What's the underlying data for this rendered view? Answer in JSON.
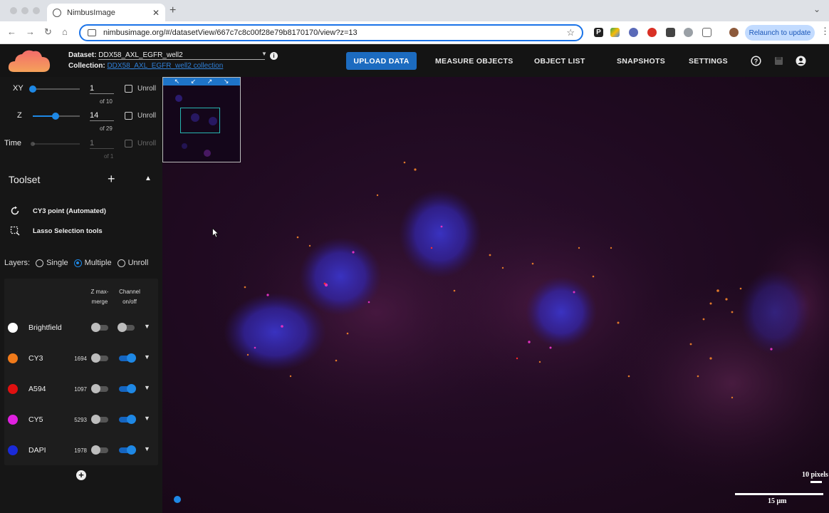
{
  "browser": {
    "tab_title": "NimbusImage",
    "url": "nimbusimage.org/#/datasetView/667c7c8c00f28e79b8170170/view?z=13",
    "relaunch_label": "Relaunch to update"
  },
  "header": {
    "dataset_label": "Dataset:",
    "dataset_name": "DDX58_AXL_EGFR_well2",
    "collection_label": "Collection:",
    "collection_name": "DDX58_AXL_EGFR_well2 collection",
    "nav": {
      "upload": "UPLOAD DATA",
      "measure": "MEASURE OBJECTS",
      "object_list": "OBJECT LIST",
      "snapshots": "SNAPSHOTS",
      "settings": "SETTINGS"
    }
  },
  "dimensions": {
    "xy": {
      "label": "XY",
      "value": "1",
      "of": "of 10",
      "unroll": "Unroll",
      "level": 0.0
    },
    "z": {
      "label": "Z",
      "value": "14",
      "of": "of 29",
      "unroll": "Unroll",
      "level": 0.46
    },
    "time": {
      "label": "Time",
      "value": "1",
      "of": "of 1",
      "unroll": "Unroll",
      "level": 0.0
    }
  },
  "toolset": {
    "title": "Toolset",
    "tools": [
      {
        "label": "CY3 point (Automated)",
        "icon": "refresh-icon"
      },
      {
        "label": "Lasso Selection tools",
        "icon": "lasso-select-icon"
      }
    ]
  },
  "layers": {
    "label": "Layers:",
    "options": [
      "Single",
      "Multiple",
      "Unroll"
    ],
    "selected": "Multiple"
  },
  "channels": {
    "col_zmax": "Z max-merge",
    "col_onoff": "Channel on/off",
    "rows": [
      {
        "name": "Brightfield",
        "value": "",
        "color": "#ffffff",
        "zmax": false,
        "on": false
      },
      {
        "name": "CY3",
        "value": "1694",
        "color": "#f07a1a",
        "zmax": false,
        "on": true
      },
      {
        "name": "A594",
        "value": "1097",
        "color": "#e01010",
        "zmax": false,
        "on": true
      },
      {
        "name": "CY5",
        "value": "5293",
        "color": "#e020e0",
        "zmax": false,
        "on": true
      },
      {
        "name": "DAPI",
        "value": "1978",
        "color": "#1a2ad8",
        "zmax": false,
        "on": true
      }
    ]
  },
  "viewer": {
    "scale_pixels": "10 pixels",
    "scale_um": "15 μm"
  }
}
